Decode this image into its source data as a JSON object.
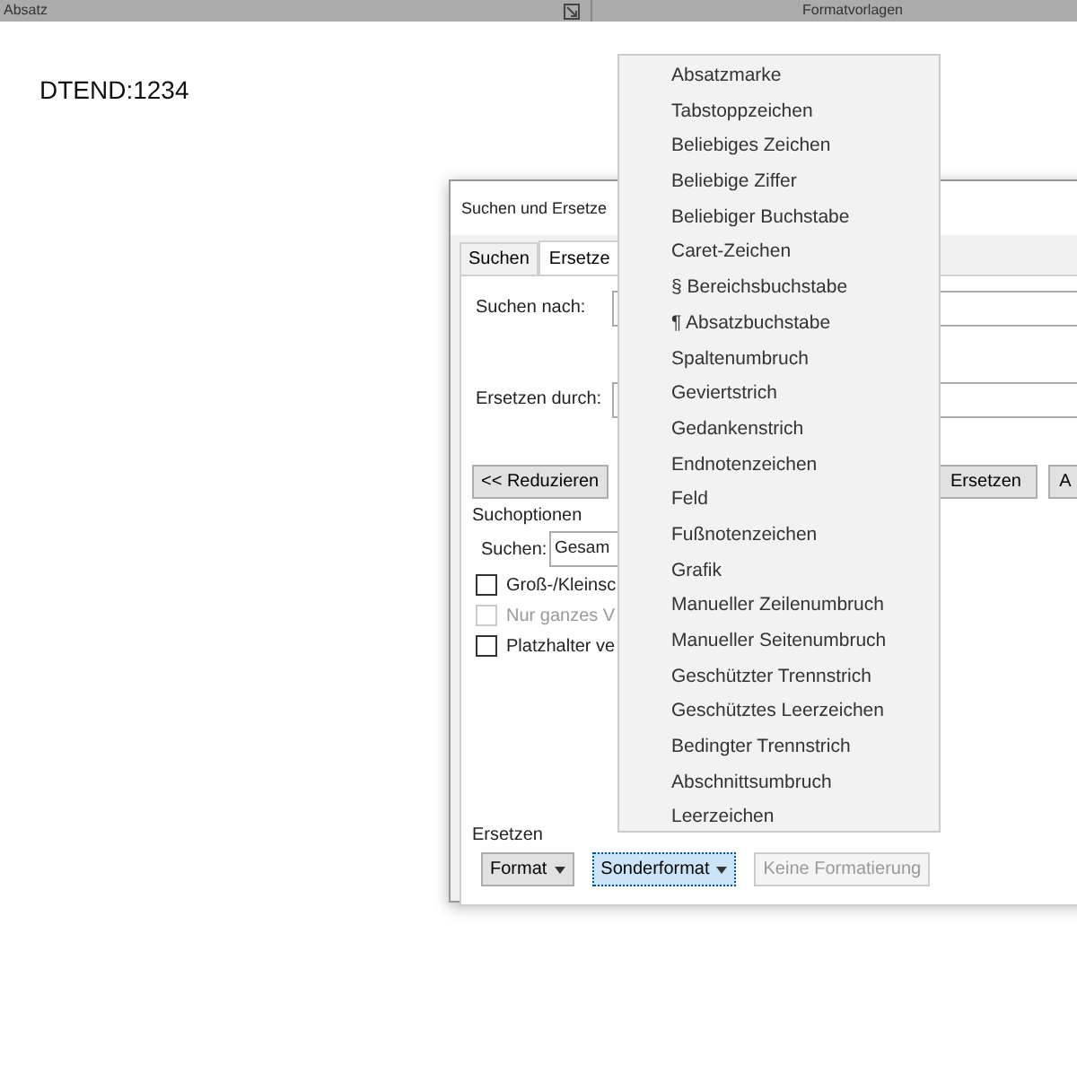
{
  "ribbon": {
    "groups": [
      {
        "label": "Absatz",
        "launcher": true
      },
      {
        "label": "Formatvorlagen",
        "launcher": false
      }
    ]
  },
  "document": {
    "text": "DTEND:1234"
  },
  "dialog": {
    "title": "Suchen und Ersetze",
    "tabs": [
      {
        "label": "Suchen",
        "selected": false
      },
      {
        "label": "Ersetze",
        "selected": true
      }
    ],
    "find_label": "Suchen nach:",
    "replace_label": "Ersetzen durch:",
    "action_buttons": [
      "<< Reduzieren",
      "Ersetzen",
      "A"
    ],
    "options_title": "Suchoptionen",
    "search_label": "Suchen:",
    "search_value": "Gesam",
    "checkboxes": [
      {
        "label": "Groß-/Kleinsc",
        "checked": false,
        "disabled": false
      },
      {
        "label": "Nur ganzes V",
        "checked": false,
        "disabled": true
      },
      {
        "label": "Platzhalter ve",
        "checked": false,
        "disabled": false
      }
    ],
    "replace_title": "Ersetzen",
    "format_buttons": [
      {
        "label": "Format",
        "dropdown": true,
        "selected": false,
        "disabled": false
      },
      {
        "label": "Sonderformat",
        "dropdown": true,
        "selected": true,
        "disabled": false
      },
      {
        "label": "Keine Formatierung",
        "dropdown": false,
        "selected": false,
        "disabled": true
      }
    ]
  },
  "menu": {
    "items": [
      "Absatzmarke",
      "Tabstoppzeichen",
      "Beliebiges Zeichen",
      "Beliebige Ziffer",
      "Beliebiger Buchstabe",
      "Caret-Zeichen",
      "§ Bereichsbuchstabe",
      "¶ Absatzbuchstabe",
      "Spaltenumbruch",
      "Geviertstrich",
      "Gedankenstrich",
      "Endnotenzeichen",
      "Feld",
      "Fußnotenzeichen",
      "Grafik",
      "Manueller Zeilenumbruch",
      "Manueller Seitenumbruch",
      "Geschützter Trennstrich",
      "Geschütztes Leerzeichen",
      "Bedingter Trennstrich",
      "Abschnittsumbruch",
      "Leerzeichen"
    ]
  }
}
